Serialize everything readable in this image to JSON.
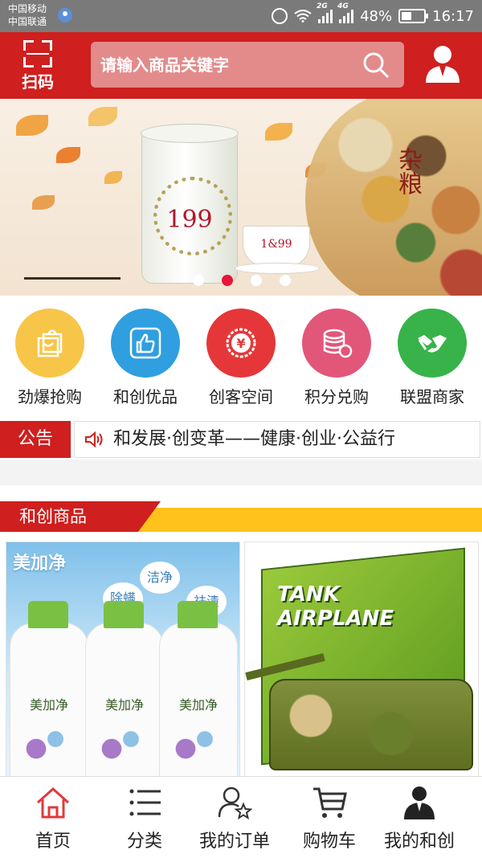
{
  "status_bar": {
    "carrier_1": "中国移动",
    "carrier_2": "中国联通",
    "net_1": "2G",
    "net_2": "4G",
    "battery": "48%",
    "time": "16:17"
  },
  "header": {
    "scan_label": "扫码",
    "search_placeholder": "请输入商品关键字",
    "accent_color": "#cf1f1f"
  },
  "banner": {
    "can_price": "199",
    "cup_text": "1&99",
    "title": "杂粮",
    "slide_count": 4,
    "active_slide": 2
  },
  "quick_menu": [
    {
      "label": "劲爆抢购",
      "icon": "shopping-bag-icon",
      "color": "#f7c548"
    },
    {
      "label": "和创优品",
      "icon": "thumbs-up-icon",
      "color": "#2f9fe0"
    },
    {
      "label": "创客空间",
      "icon": "yuan-coin-icon",
      "color": "#e5373a"
    },
    {
      "label": "积分兑购",
      "icon": "database-icon",
      "color": "#e2567a"
    },
    {
      "label": "联盟商家",
      "icon": "handshake-icon",
      "color": "#37b34a"
    }
  ],
  "notice": {
    "tag": "公告",
    "text": "和发展·创变革——健康·创业·公益行"
  },
  "section": {
    "title": "和创商品"
  },
  "products": [
    {
      "brand": "美加净",
      "tags": [
        "洁净",
        "除螨",
        "祛渍"
      ],
      "bottle_brand": "美加净"
    },
    {
      "box_line_1": "TANK",
      "box_line_2": "AIRPLANE"
    }
  ],
  "tab_bar": [
    {
      "label": "首页",
      "icon": "home-icon",
      "active": true
    },
    {
      "label": "分类",
      "icon": "list-icon",
      "active": false
    },
    {
      "label": "我的订单",
      "icon": "user-star-icon",
      "active": false
    },
    {
      "label": "购物车",
      "icon": "cart-icon",
      "active": false
    },
    {
      "label": "我的和创",
      "icon": "user-profile-icon",
      "active": false
    }
  ]
}
